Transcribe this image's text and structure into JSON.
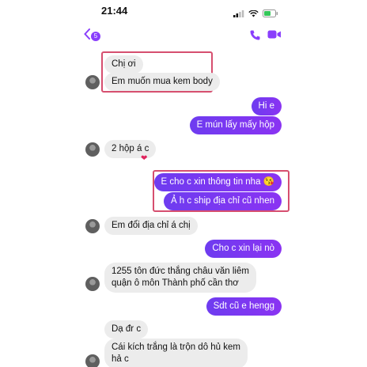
{
  "status": {
    "time": "21:44"
  },
  "header": {
    "back_count": "5"
  },
  "messages": {
    "m1": "Chị ơi",
    "m2": "Em muốn mua kem body",
    "m3": "Hi e",
    "m4": "E mún lấy mấy hộp",
    "m5": "2 hộp á c",
    "m5_reaction": "❤",
    "m6": "E cho c xin thông tin nha 😘",
    "m7": "Ả h c ship địa chỉ cũ nhen",
    "m8": "Em đổi địa chỉ á chị",
    "m9": "Cho c xin lại nò",
    "m10_line1": "1255 tôn đức thắng châu văn liêm",
    "m10_line2": "quận ô môn Thành phố cần thơ",
    "m11": "Sdt cũ e hengg",
    "m12": "Dạ đr c",
    "m13_line1": "Cái kích trắng là trộn dô hủ kem",
    "m13_line2": "hả c"
  },
  "colors": {
    "outgoing": "#7b3ff2",
    "incoming": "#ececec",
    "highlight": "#d64f6f",
    "accent": "#8a3ffc"
  }
}
